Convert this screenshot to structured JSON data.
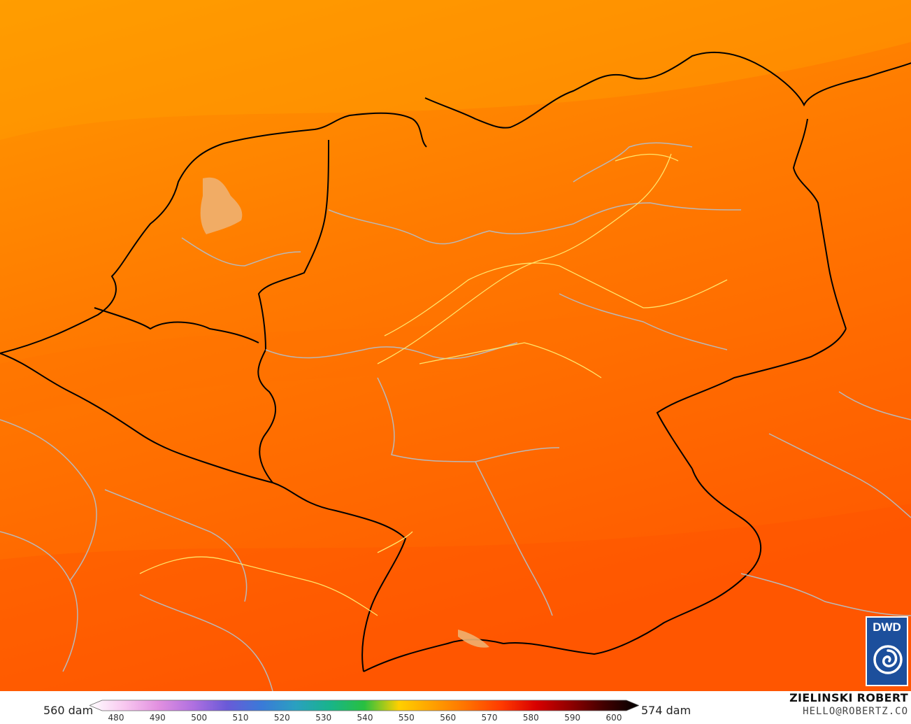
{
  "map": {
    "colors": {
      "north": "#ff9a00",
      "middle": "#ff7a00",
      "south": "#ff5a00",
      "border_country": "#000000",
      "border_region": "#b9b9b9",
      "contour": "#ffe56a"
    }
  },
  "legend": {
    "min_label": "560 dam",
    "max_label": "574 dam",
    "ticks": [
      "480",
      "490",
      "500",
      "510",
      "520",
      "530",
      "540",
      "550",
      "560",
      "570",
      "580",
      "590",
      "600"
    ],
    "gradient_colors": [
      "#ffffff",
      "#f8c8f0",
      "#e290e0",
      "#b070e0",
      "#6a5ad8",
      "#3a7ad8",
      "#2aa0c0",
      "#18b48a",
      "#28c040",
      "#ffd000",
      "#ffa000",
      "#ff7000",
      "#ff3a00",
      "#d80000",
      "#900000",
      "#400000",
      "#000000"
    ]
  },
  "credit": {
    "author": "ZIELINSKI ROBERT",
    "email": "HELLO@ROBERTZ.CO"
  },
  "logo": {
    "text": "DWD",
    "icon": "dwd-swirl-icon"
  }
}
